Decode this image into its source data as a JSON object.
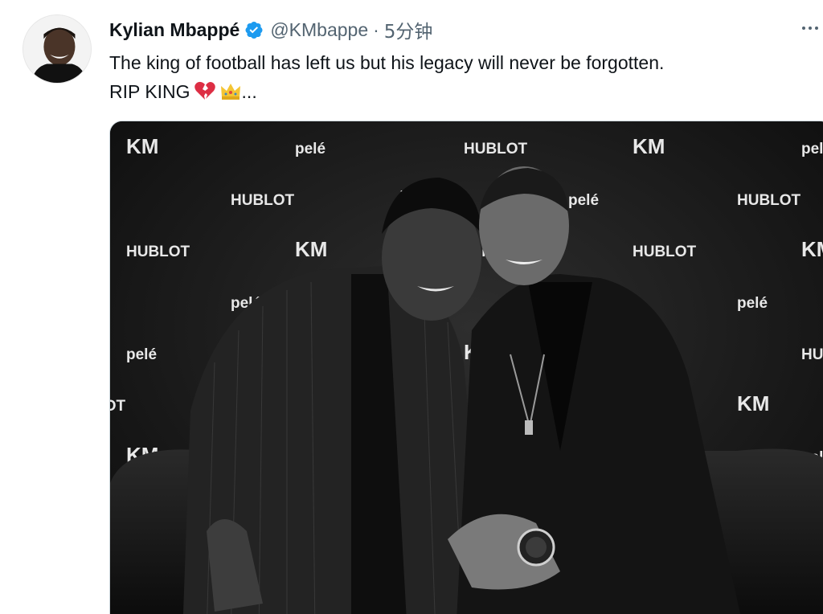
{
  "tweet": {
    "author_name": "Kylian Mbappé",
    "handle": "@KMbappe",
    "separator": "·",
    "time": "5分钟",
    "text_line1": "The king of football has left us but his legacy will never be forgotten.",
    "text_line2": "RIP KING",
    "ellipsis": "...",
    "verified_color": "#1d9bf0"
  },
  "media": {
    "backdrop_brands": [
      "KM",
      "pelé",
      "HUBLOT"
    ],
    "description_icons": [
      "broken-heart-icon",
      "crown-icon",
      "more-icon",
      "verified-badge-icon"
    ]
  }
}
